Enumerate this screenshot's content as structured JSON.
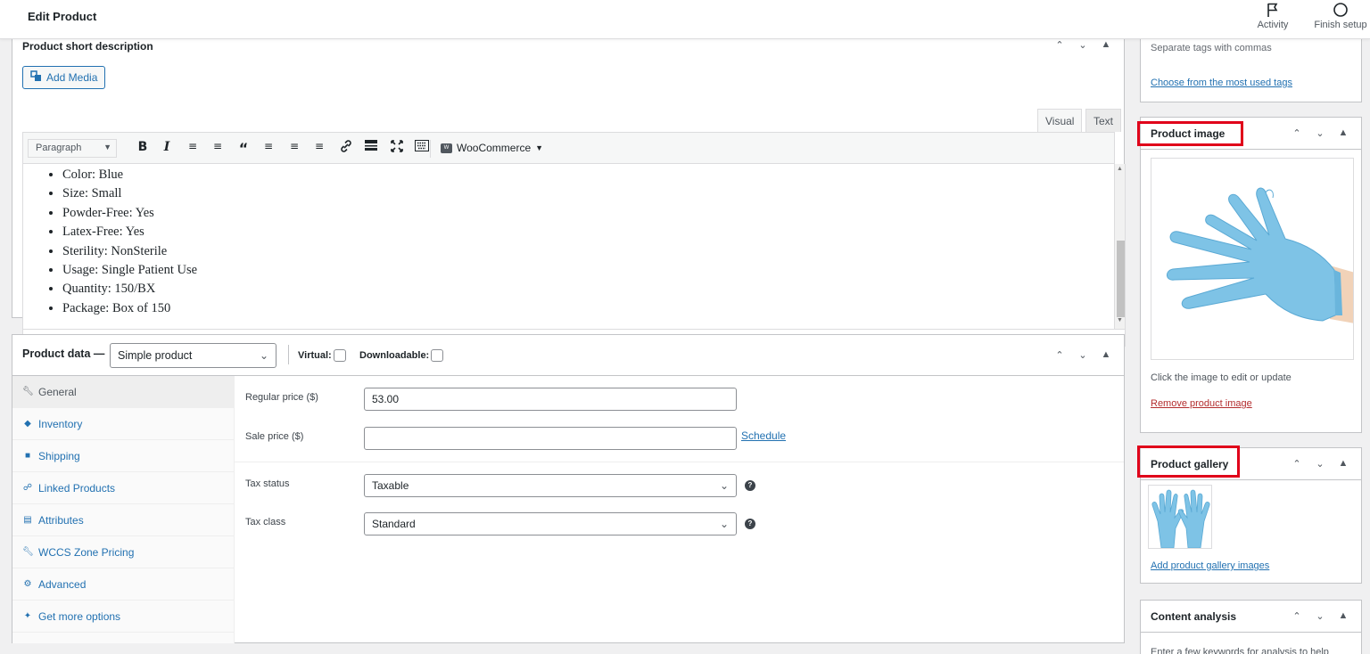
{
  "topbar": {
    "title": "Edit Product",
    "activity_label": "Activity",
    "finish_label": "Finish setup"
  },
  "short_description": {
    "title": "Product short description",
    "add_media": "Add Media",
    "tab_visual": "Visual",
    "tab_text": "Text",
    "format_select": "Paragraph",
    "woocommerce_menu": "WooCommerce",
    "items": [
      "Color: Blue",
      "Size: Small",
      "Powder-Free: Yes",
      "Latex-Free: Yes",
      "Sterility: NonSterile",
      "Usage: Single Patient Use",
      "Quantity: 150/BX",
      "Package: Box of 150"
    ]
  },
  "product_data": {
    "title": "Product data —",
    "type_value": "Simple product",
    "virtual_label": "Virtual:",
    "downloadable_label": "Downloadable:",
    "tabs": [
      {
        "label": "General",
        "icon": "wrench-icon"
      },
      {
        "label": "Inventory",
        "icon": "tag-icon"
      },
      {
        "label": "Shipping",
        "icon": "truck-icon"
      },
      {
        "label": "Linked Products",
        "icon": "link-icon"
      },
      {
        "label": "Attributes",
        "icon": "list-icon"
      },
      {
        "label": "WCCS Zone Pricing",
        "icon": "wrench-icon"
      },
      {
        "label": "Advanced",
        "icon": "gear-icon"
      },
      {
        "label": "Get more options",
        "icon": "plugin-icon"
      }
    ],
    "regular_price_label": "Regular price ($)",
    "regular_price_value": "53.00",
    "sale_price_label": "Sale price ($)",
    "sale_price_value": "",
    "schedule_link": "Schedule",
    "tax_status_label": "Tax status",
    "tax_status_value": "Taxable",
    "tax_class_label": "Tax class",
    "tax_class_value": "Standard"
  },
  "sidebar": {
    "tags_hint": "Separate tags with commas",
    "tags_link": "Choose from the most used tags",
    "product_image_title": "Product image",
    "image_hint": "Click the image to edit or update",
    "remove_image": "Remove product image",
    "gallery_title": "Product gallery",
    "add_gallery": "Add product gallery images",
    "content_analysis_title": "Content analysis",
    "content_analysis_hint": "Enter a few keywords for analysis to help"
  },
  "colors": {
    "accent": "#2271b1",
    "highlight_frame": "#e0001a",
    "glove": "#7ec3e6"
  }
}
